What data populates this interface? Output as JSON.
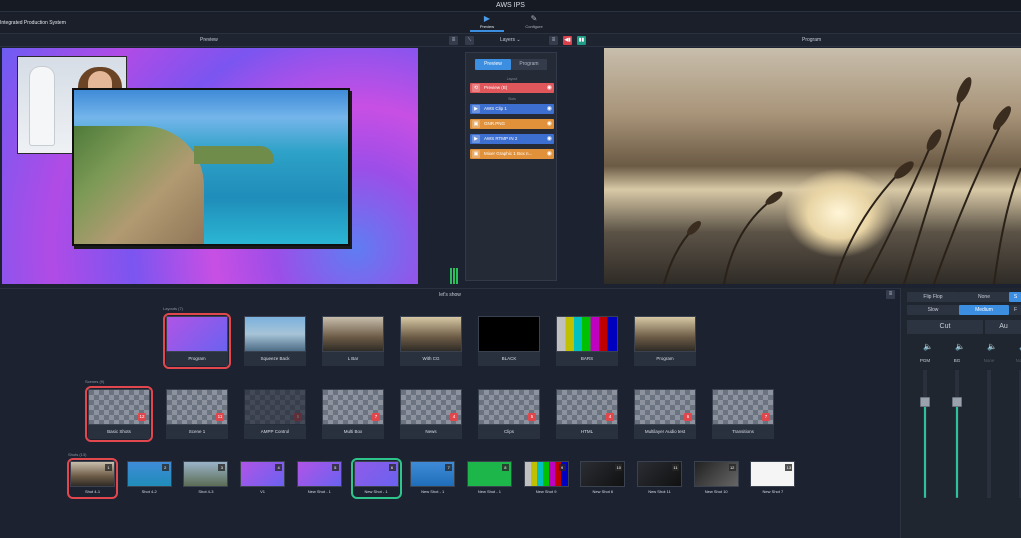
{
  "app": {
    "title": "AWS IPS",
    "system_name": "Integrated Production System"
  },
  "top_nav": [
    {
      "label": "Preview",
      "icon": "preview-icon",
      "active": true
    },
    {
      "label": "Configure",
      "icon": "configure-icon",
      "active": false
    }
  ],
  "sections": {
    "preview": "Preview",
    "program": "Program",
    "layers": "Layers"
  },
  "layers_panel": {
    "tabs": [
      "Preview",
      "Program"
    ],
    "groups": {
      "layout": "Layout",
      "slots": "Slots"
    },
    "items": [
      {
        "label": "Preview (B)",
        "color": "#e0575b"
      },
      {
        "label": "AWS Clip 1",
        "color": "#3d6fd0"
      },
      {
        "label": "GNR.PNG",
        "color": "#e0913a"
      },
      {
        "label": "AWS RTMP IN 2",
        "color": "#3d6fd0"
      },
      {
        "label": "Mixer Graphic 1 Box n...",
        "color": "#e0913a"
      }
    ]
  },
  "show": {
    "title": "let's show"
  },
  "layouts": {
    "label": "Layouts (7)",
    "items": [
      "Program",
      "Squeeze Back",
      "L Bar",
      "With CG",
      "BLACK",
      "BARS",
      "Program"
    ]
  },
  "scenes": {
    "label": "Scenes (9)",
    "items": [
      {
        "label": "Basic Shots",
        "count": "12"
      },
      {
        "label": "Scene 1",
        "count": "11"
      },
      {
        "label": "AMPP Control",
        "count": "5"
      },
      {
        "label": "Multi Box",
        "count": "7"
      },
      {
        "label": "News",
        "count": "4"
      },
      {
        "label": "Clips",
        "count": "5"
      },
      {
        "label": "HTML",
        "count": "4"
      },
      {
        "label": "Multilayer Audio test",
        "count": "6"
      },
      {
        "label": "Transitions",
        "count": "7"
      }
    ]
  },
  "shots": {
    "label": "Shots (13)",
    "items": [
      {
        "label": "Shot 4-1",
        "num": "1"
      },
      {
        "label": "Shot 4-2",
        "num": "2"
      },
      {
        "label": "Shot 4-3",
        "num": "3"
      },
      {
        "label": "V1",
        "num": "4"
      },
      {
        "label": "New Shot - 1",
        "num": "5"
      },
      {
        "label": "New Shot - 1",
        "num": "6"
      },
      {
        "label": "New Shot - 1",
        "num": "7"
      },
      {
        "label": "New Shot - 1",
        "num": "8"
      },
      {
        "label": "New Shot 9",
        "num": "9"
      },
      {
        "label": "New Shot 6",
        "num": "10"
      },
      {
        "label": "New Shot 11",
        "num": "11"
      },
      {
        "label": "New Shot 10",
        "num": "12"
      },
      {
        "label": "New Shot 7",
        "num": "13"
      }
    ]
  },
  "transition_panel": {
    "row1": [
      "Flip Flop",
      "None",
      "S"
    ],
    "row2": [
      "Slow",
      "Medium",
      "F"
    ],
    "row3": [
      "Cut",
      "Au"
    ]
  },
  "audio_channels": [
    {
      "label": "PGM",
      "level": 0.74
    },
    {
      "label": "BG",
      "level": 0.74
    },
    {
      "label": "None",
      "level": 0.0
    },
    {
      "label": "None",
      "level": 0.0
    }
  ],
  "colors": {
    "accent": "#3b8ee0",
    "selected_red": "#e3474e",
    "selected_green": "#2ec58c"
  }
}
